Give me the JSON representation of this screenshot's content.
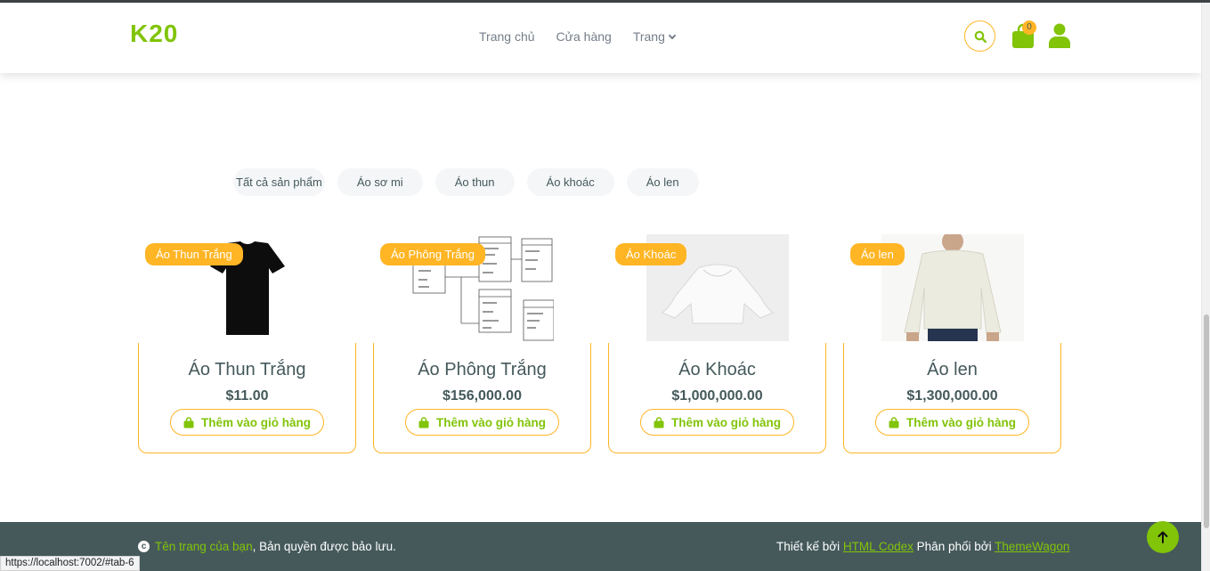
{
  "brand": "K20",
  "nav": {
    "home": "Trang chủ",
    "shop": "Cửa hàng",
    "pages": "Trang"
  },
  "cart": {
    "count": "0"
  },
  "tabs": [
    "Tất cả sản phẩm",
    "Áo sơ mi",
    "Áo thun",
    "Áo khoác",
    "Áo len"
  ],
  "products": [
    {
      "badge": "Áo Thun Trắng",
      "title": "Áo Thun Trắng",
      "price": "$11.00",
      "button": "Thêm vào giỏ hàng"
    },
    {
      "badge": "Áo Phông Trắng",
      "title": "Áo Phông Trắng",
      "price": "$156,000.00",
      "button": "Thêm vào giỏ hàng"
    },
    {
      "badge": "Áo Khoác",
      "title": "Áo Khoác",
      "price": "$1,000,000.00",
      "button": "Thêm vào giỏ hàng"
    },
    {
      "badge": "Áo len",
      "title": "Áo len",
      "price": "$1,300,000.00",
      "button": "Thêm vào giỏ hàng"
    }
  ],
  "footer": {
    "site_name": "Tên trang của bạn",
    "rights": ", Bản quyền được bảo lưu.",
    "designed_by": "Thiết kế bởi ",
    "designer": "HTML Codex",
    "distributed_by": " Phân phối bởi ",
    "distributor": "ThemeWagon"
  },
  "status_url": "https://localhost:7002/#tab-6",
  "colors": {
    "primary": "#81c408",
    "secondary": "#ffb524",
    "dark": "#45595b"
  }
}
